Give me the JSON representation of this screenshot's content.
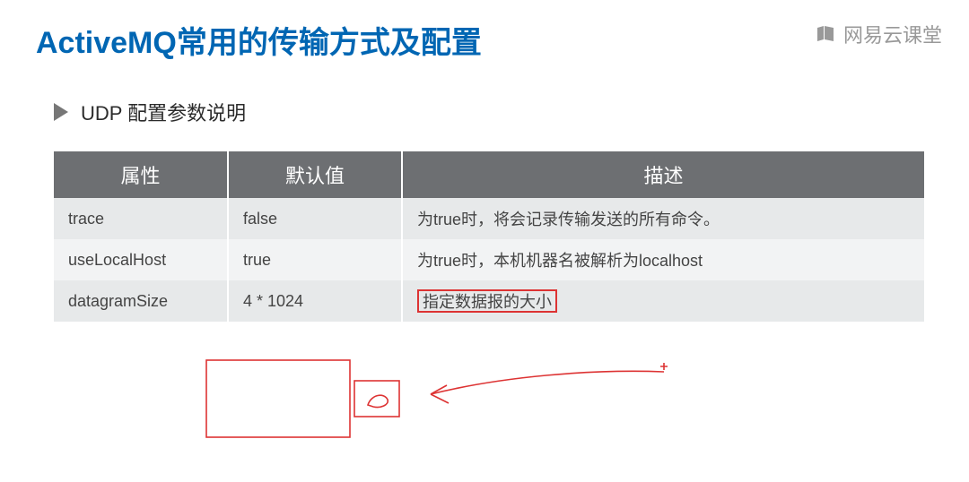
{
  "title": "ActiveMQ常用的传输方式及配置",
  "watermark": "网易云课堂",
  "section": {
    "heading": "UDP 配置参数说明",
    "columns": {
      "attr": "属性",
      "default": "默认值",
      "desc": "描述"
    },
    "rows": [
      {
        "attr": "trace",
        "default": "false",
        "desc": "为true时，将会记录传输发送的所有命令。"
      },
      {
        "attr": "useLocalHost",
        "default": "true",
        "desc": "为true时，本机机器名被解析为localhost"
      },
      {
        "attr": "datagramSize",
        "default": "4 * 1024",
        "desc": "指定数据报的大小"
      }
    ]
  }
}
